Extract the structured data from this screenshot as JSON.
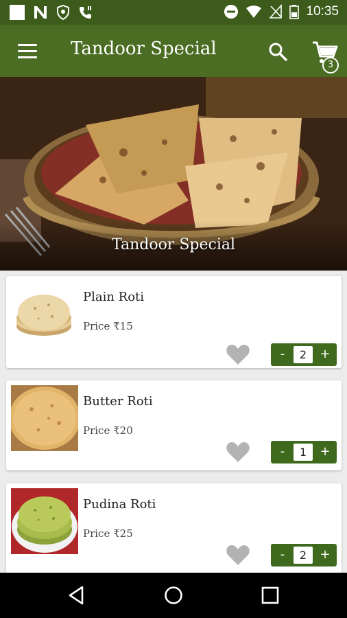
{
  "status_bar": {
    "time": "10:35",
    "left_icons": [
      "notification-square-icon",
      "n-app-icon",
      "shield-icon",
      "phone-icon"
    ],
    "right_icons": [
      "do-not-disturb-icon",
      "wifi-icon",
      "no-signal-icon",
      "battery-icon"
    ]
  },
  "app_bar": {
    "title": "Tandoor Special",
    "menu_icon": "hamburger-menu-icon",
    "search_icon": "search-icon",
    "cart_icon": "shopping-cart-icon",
    "cart_count": "3"
  },
  "hero": {
    "title": "Tandoor Special"
  },
  "items": [
    {
      "name": "Plain Roti",
      "price": "Price ₹15",
      "quantity": "2",
      "minus": "-",
      "plus": "+"
    },
    {
      "name": "Butter Roti",
      "price": "Price ₹20",
      "quantity": "1",
      "minus": "-",
      "plus": "+"
    },
    {
      "name": "Pudina Roti",
      "price": "Price ₹25",
      "quantity": "2",
      "minus": "-",
      "plus": "+"
    }
  ],
  "nav_bar": {
    "buttons": [
      "back-icon",
      "home-icon",
      "recents-icon"
    ]
  },
  "colors": {
    "status_bar": "#3d5c1b",
    "app_bar": "#4b6d23",
    "stepper": "#3f6a1d",
    "heart": "#b3b3b3",
    "background": "#ececec"
  }
}
